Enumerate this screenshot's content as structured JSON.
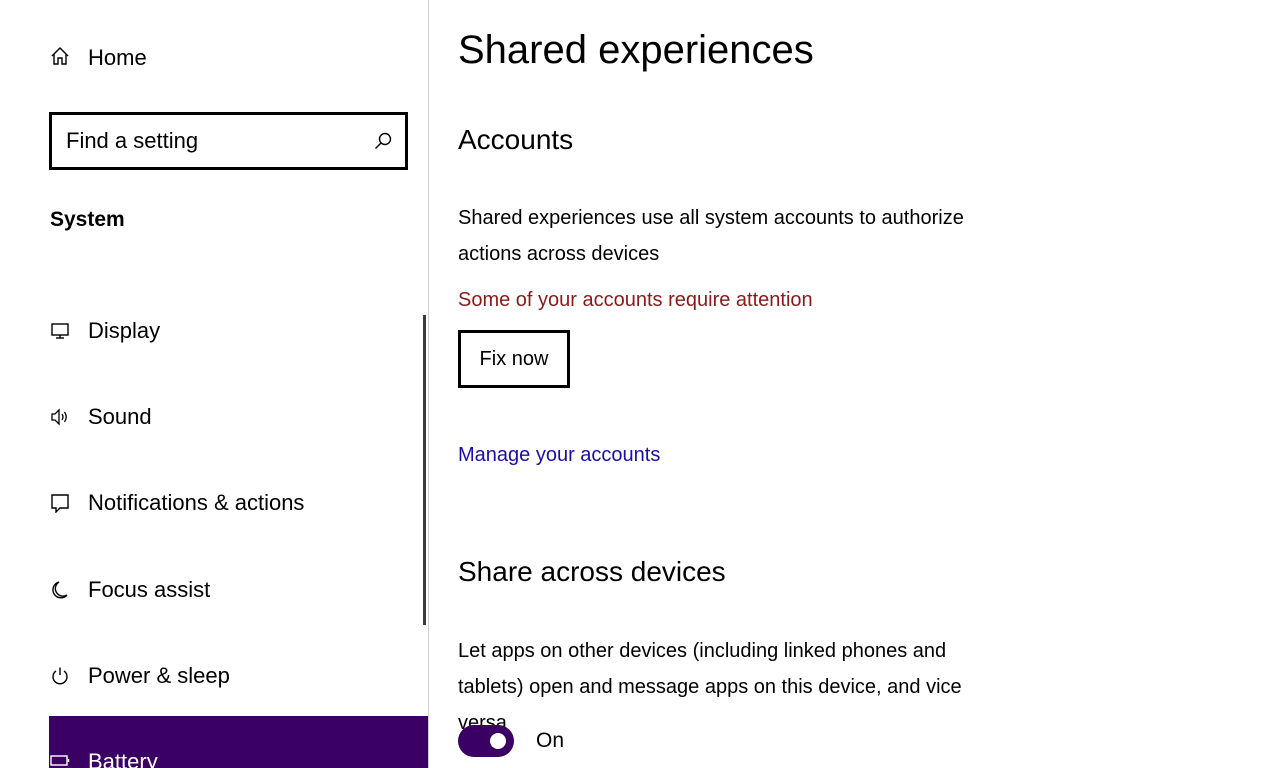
{
  "sidebar": {
    "home_label": "Home",
    "search": {
      "placeholder": "Find a setting"
    },
    "section_label": "System",
    "items": [
      {
        "label": "Display",
        "icon": "monitor-icon"
      },
      {
        "label": "Sound",
        "icon": "speaker-icon"
      },
      {
        "label": "Notifications & actions",
        "icon": "notification-icon"
      },
      {
        "label": "Focus assist",
        "icon": "moon-icon"
      },
      {
        "label": "Power & sleep",
        "icon": "power-icon"
      },
      {
        "label": "Battery",
        "icon": "battery-icon",
        "selected": true
      }
    ]
  },
  "content": {
    "title": "Shared experiences",
    "accounts": {
      "heading": "Accounts",
      "description": "Shared experiences use all system accounts to authorize actions across devices",
      "warning": "Some of your accounts require attention",
      "fix_button": "Fix now",
      "manage_link": "Manage your accounts"
    },
    "share": {
      "heading": "Share across devices",
      "description": "Let apps on other devices (including linked phones and tablets) open and message apps on this device, and vice versa",
      "toggle_state": "On",
      "toggle_on": true
    }
  },
  "colors": {
    "accent": "#3b0064",
    "warning": "#8a1a1a",
    "link": "#1a0dab"
  }
}
